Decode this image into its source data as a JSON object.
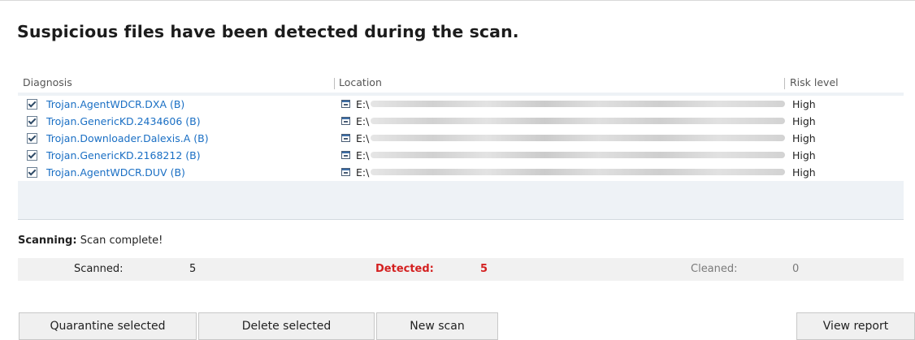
{
  "title": "Suspicious files have been detected during the scan.",
  "table": {
    "headers": {
      "diagnosis": "Diagnosis",
      "location": "Location",
      "risk": "Risk level"
    },
    "rows": [
      {
        "diagnosis": "Trojan.AgentWDCR.DXA (B)",
        "location": "E:\\",
        "risk": "High",
        "checked": true
      },
      {
        "diagnosis": "Trojan.GenericKD.2434606 (B)",
        "location": "E:\\",
        "risk": "High",
        "checked": true
      },
      {
        "diagnosis": "Trojan.Downloader.Dalexis.A (B)",
        "location": "E:\\",
        "risk": "High",
        "checked": true
      },
      {
        "diagnosis": "Trojan.GenericKD.2168212 (B)",
        "location": "E:\\",
        "risk": "High",
        "checked": true
      },
      {
        "diagnosis": "Trojan.AgentWDCR.DUV (B)",
        "location": "E:\\",
        "risk": "High",
        "checked": true
      }
    ]
  },
  "status": {
    "label": "Scanning:",
    "value": "Scan complete!"
  },
  "stats": {
    "scanned_label": "Scanned:",
    "scanned_value": "5",
    "detected_label": "Detected:",
    "detected_value": "5",
    "cleaned_label": "Cleaned:",
    "cleaned_value": "0"
  },
  "buttons": {
    "quarantine": "Quarantine selected",
    "delete": "Delete selected",
    "new_scan": "New scan",
    "view_report": "View report"
  },
  "colors": {
    "link": "#1a6fc4",
    "detected": "#d42020",
    "list_bg": "#eef2f6"
  },
  "icons": [
    "checkbox-checked-icon",
    "drive-icon"
  ]
}
